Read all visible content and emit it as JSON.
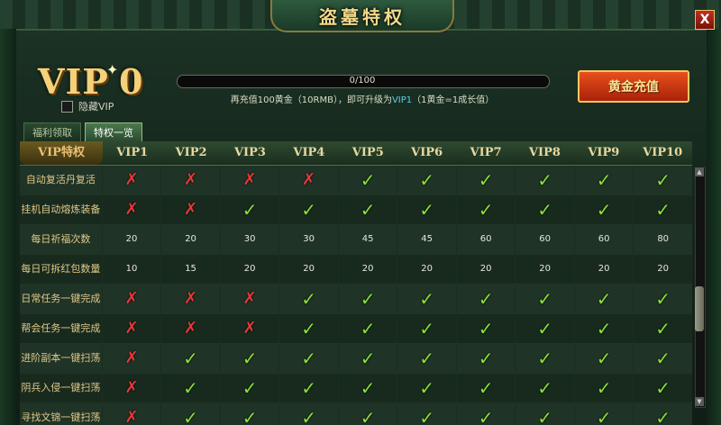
{
  "window": {
    "title": "盗墓特权",
    "close_label": "X"
  },
  "vip": {
    "badge": "VIP",
    "level": "0",
    "sparkle": "✦",
    "hide_vip_label": "隐藏VIP"
  },
  "progress": {
    "label": "0/100",
    "fraction": 0.0
  },
  "recharge_hint": {
    "prefix": "再充值100黄金（10RMB），即可升级为",
    "accent": "VIP1",
    "suffix": "（1黄金=1成长值）"
  },
  "recharge_button": {
    "label": "黄金充值"
  },
  "tabs": [
    {
      "label": "福利领取",
      "active": false
    },
    {
      "label": "特权一览",
      "active": true
    }
  ],
  "table": {
    "corner_label": "VIP特权",
    "columns": [
      "VIP1",
      "VIP2",
      "VIP3",
      "VIP4",
      "VIP5",
      "VIP6",
      "VIP7",
      "VIP8",
      "VIP9",
      "VIP10"
    ],
    "rows": [
      {
        "label": "自动复活丹复活",
        "cells": [
          "✗",
          "✗",
          "✗",
          "✗",
          "✓",
          "✓",
          "✓",
          "✓",
          "✓",
          "✓"
        ]
      },
      {
        "label": "挂机自动熔炼装备",
        "cells": [
          "✗",
          "✗",
          "✓",
          "✓",
          "✓",
          "✓",
          "✓",
          "✓",
          "✓",
          "✓"
        ]
      },
      {
        "label": "每日祈福次数",
        "cells": [
          "20",
          "20",
          "30",
          "30",
          "45",
          "45",
          "60",
          "60",
          "60",
          "80"
        ]
      },
      {
        "label": "每日可拆红包数量",
        "cells": [
          "10",
          "15",
          "20",
          "20",
          "20",
          "20",
          "20",
          "20",
          "20",
          "20"
        ]
      },
      {
        "label": "日常任务一键完成",
        "cells": [
          "✗",
          "✗",
          "✗",
          "✓",
          "✓",
          "✓",
          "✓",
          "✓",
          "✓",
          "✓"
        ]
      },
      {
        "label": "帮会任务一键完成",
        "cells": [
          "✗",
          "✗",
          "✗",
          "✓",
          "✓",
          "✓",
          "✓",
          "✓",
          "✓",
          "✓"
        ]
      },
      {
        "label": "进阶副本一键扫荡",
        "cells": [
          "✗",
          "✓",
          "✓",
          "✓",
          "✓",
          "✓",
          "✓",
          "✓",
          "✓",
          "✓"
        ]
      },
      {
        "label": "阴兵入侵一键扫荡",
        "cells": [
          "✗",
          "✓",
          "✓",
          "✓",
          "✓",
          "✓",
          "✓",
          "✓",
          "✓",
          "✓"
        ]
      },
      {
        "label": "寻找文锦一键扫荡",
        "cells": [
          "✗",
          "✓",
          "✓",
          "✓",
          "✓",
          "✓",
          "✓",
          "✓",
          "✓",
          "✓"
        ]
      }
    ]
  },
  "colors": {
    "check": "#8ae03a",
    "cross": "#e83838",
    "gold": "#f3d27a"
  },
  "icons": {
    "check": "check-icon",
    "cross": "cross-icon",
    "close": "close-icon"
  }
}
